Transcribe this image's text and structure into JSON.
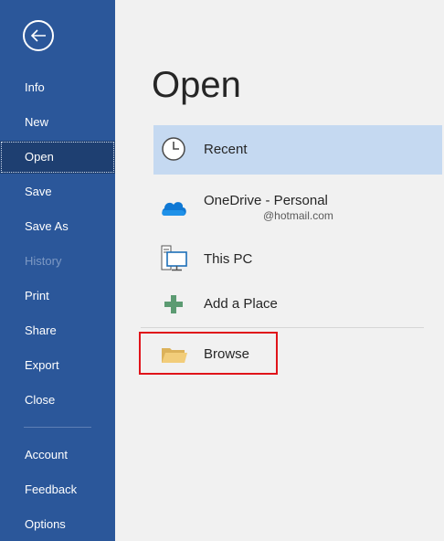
{
  "sidebar": {
    "back_icon": "arrow-left-icon",
    "items": [
      {
        "label": "Info"
      },
      {
        "label": "New"
      },
      {
        "label": "Open"
      },
      {
        "label": "Save"
      },
      {
        "label": "Save As"
      },
      {
        "label": "History"
      },
      {
        "label": "Print"
      },
      {
        "label": "Share"
      },
      {
        "label": "Export"
      },
      {
        "label": "Close"
      }
    ],
    "bottom_items": [
      {
        "label": "Account"
      },
      {
        "label": "Feedback"
      },
      {
        "label": "Options"
      }
    ],
    "selected": "Open",
    "disabled": "History"
  },
  "main": {
    "title": "Open",
    "locations": [
      {
        "label": "Recent",
        "icon": "clock-icon"
      },
      {
        "label": "OneDrive - Personal",
        "sub": "@hotmail.com",
        "icon": "cloud-icon"
      },
      {
        "label": "This PC",
        "icon": "computer-icon"
      },
      {
        "label": "Add a Place",
        "icon": "plus-icon"
      },
      {
        "label": "Browse",
        "icon": "folder-icon"
      }
    ]
  },
  "colors": {
    "sidebar_bg": "#2b579a",
    "sidebar_selected": "#1e3f71",
    "main_bg": "#f1f1f1",
    "recent_highlight": "#c5d9f1",
    "annotation_red": "#e0141a"
  }
}
